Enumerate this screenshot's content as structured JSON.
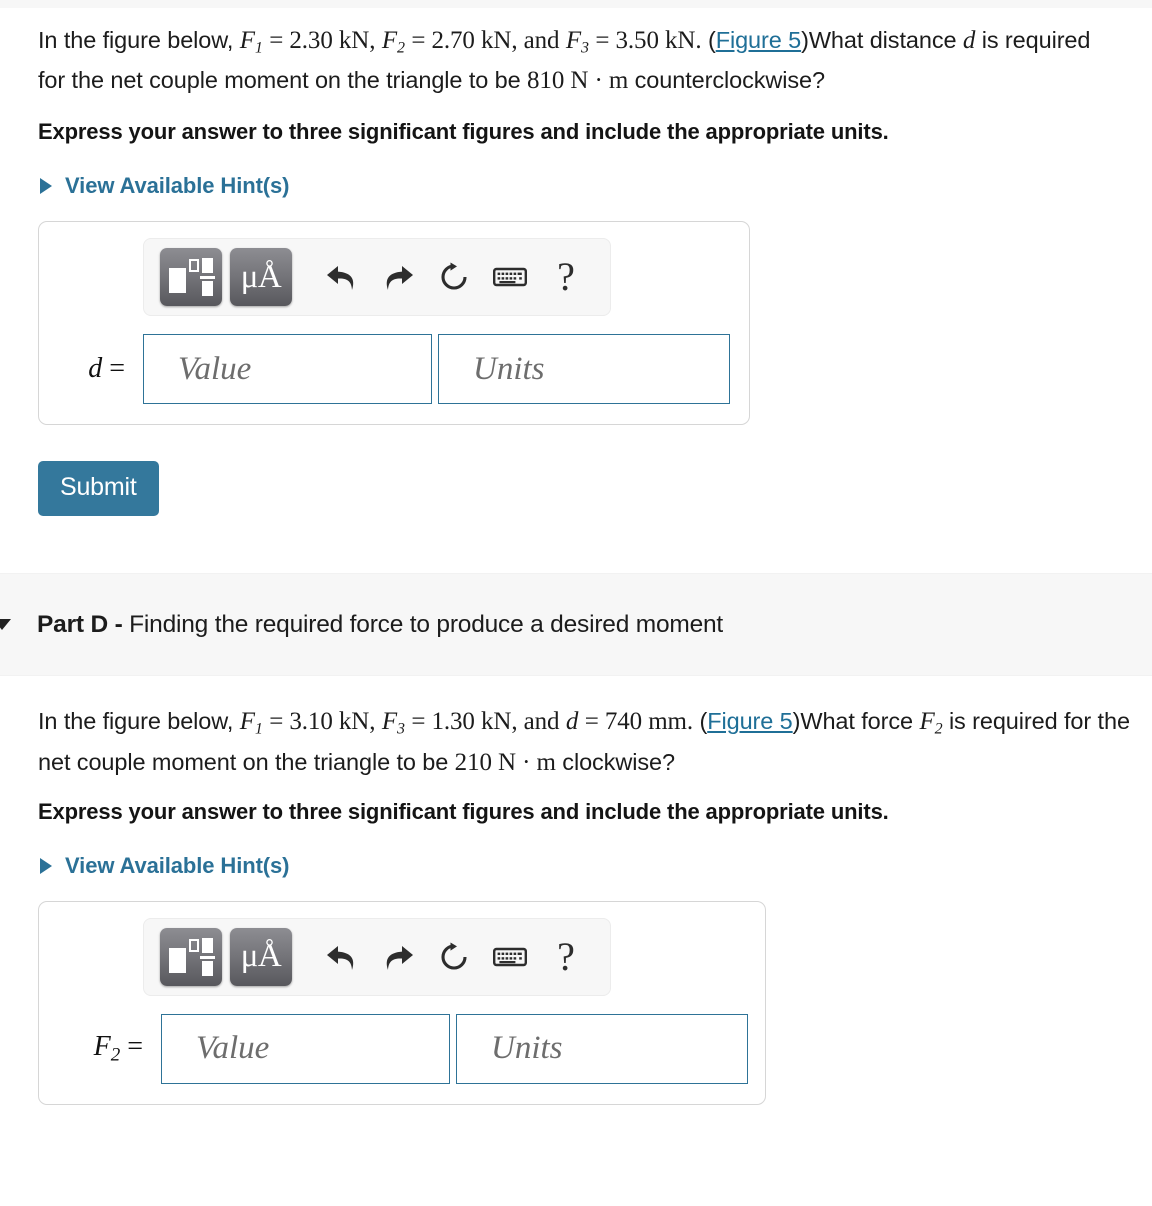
{
  "part_c": {
    "question": {
      "lead": "In the figure below,",
      "f1_symbol": "F",
      "f1_sub": "1",
      "f1_value": "= 2.30 kN,",
      "f2_symbol": "F",
      "f2_sub": "2",
      "f2_value": "= 2.70 kN, and",
      "f3_symbol": "F",
      "f3_sub": "3",
      "f3_value": "= 3.50 kN.",
      "figure_link": "Figure 5",
      "after_link": ")What distance",
      "d_symbol": "d",
      "tail": "is required for the net couple moment on the triangle to be",
      "moment_value": "810 N · m",
      "tail2": "counterclockwise?"
    },
    "instruction": "Express your answer to three significant figures and include the appropriate units.",
    "hints_label": "View Available Hint(s)",
    "toolbar": {
      "template_title": "math-templates",
      "units_label": "μÅ",
      "undo_title": "undo",
      "redo_title": "redo",
      "reset_title": "reset",
      "keyboard_title": "keyboard",
      "help_label": "?"
    },
    "answer": {
      "variable": "d",
      "equals": "=",
      "value_placeholder": "Value",
      "units_placeholder": "Units"
    },
    "submit_label": "Submit"
  },
  "part_d": {
    "header_part": "Part D",
    "header_sep": "-",
    "header_desc": "Finding the required force to produce a desired moment",
    "question": {
      "lead": "In the figure below,",
      "f1_symbol": "F",
      "f1_sub": "1",
      "f1_value": "= 3.10 kN,",
      "f3_symbol": "F",
      "f3_sub": "3",
      "f3_value": "= 1.30 kN, and",
      "d_symbol": "d",
      "d_value": "= 740 mm.",
      "figure_link": "Figure 5",
      "after_link": ")What force",
      "f2_symbol": "F",
      "f2_sub": "2",
      "tail": "is required for the net couple moment on the triangle to be",
      "moment_value": "210 N · m",
      "tail2": "clockwise?"
    },
    "instruction": "Express your answer to three significant figures and include the appropriate units.",
    "hints_label": "View Available Hint(s)",
    "toolbar": {
      "units_label": "μÅ",
      "help_label": "?"
    },
    "answer": {
      "variable": "F",
      "variable_sub": "2",
      "equals": "=",
      "value_placeholder": "Value",
      "units_placeholder": "Units"
    }
  },
  "colors": {
    "link": "#1f6f97",
    "hint": "#2b7197",
    "submit_bg": "#34789c",
    "input_border": "#2e7397",
    "band_bg": "#f7f7f7"
  }
}
